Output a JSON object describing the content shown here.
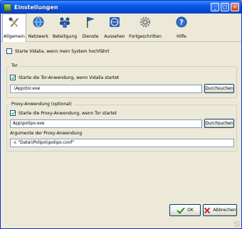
{
  "window": {
    "title": "Einstellungen"
  },
  "toolbar": {
    "items": [
      {
        "label": "Allgemein",
        "icon": "tools-icon"
      },
      {
        "label": "Netzwerk",
        "icon": "globe-icon"
      },
      {
        "label": "Beteiligung",
        "icon": "people-icon"
      },
      {
        "label": "Dienste",
        "icon": "flag-icon"
      },
      {
        "label": "Aussehen",
        "icon": "globe-flag-icon"
      },
      {
        "label": "Fortgeschritten",
        "icon": "gear-icon"
      },
      {
        "label": "Hilfe",
        "icon": "help-icon"
      }
    ]
  },
  "general": {
    "startup_label": "Starte Vidalia, wenn mein System hochfährt"
  },
  "tor": {
    "group_title": "Tor",
    "start_label": "Starte die Tor-Anwendung, wenn Vidalia startet",
    "path": ".\\App\\tor.exe",
    "browse": "Durchsuchen"
  },
  "proxy": {
    "group_title": "Proxy-Anwendung (optional)",
    "start_label": "Starte die Proxy-Anwendung, wenn Tor startet",
    "path": "App\\polipo.exe",
    "browse": "Durchsuchen",
    "args_label": "Argumente der Proxy-Anwendung",
    "args": "-c \"Data\\\\Polipo\\\\polipo.conf\""
  },
  "footer": {
    "ok": "OK",
    "cancel": "Abbrechen"
  }
}
